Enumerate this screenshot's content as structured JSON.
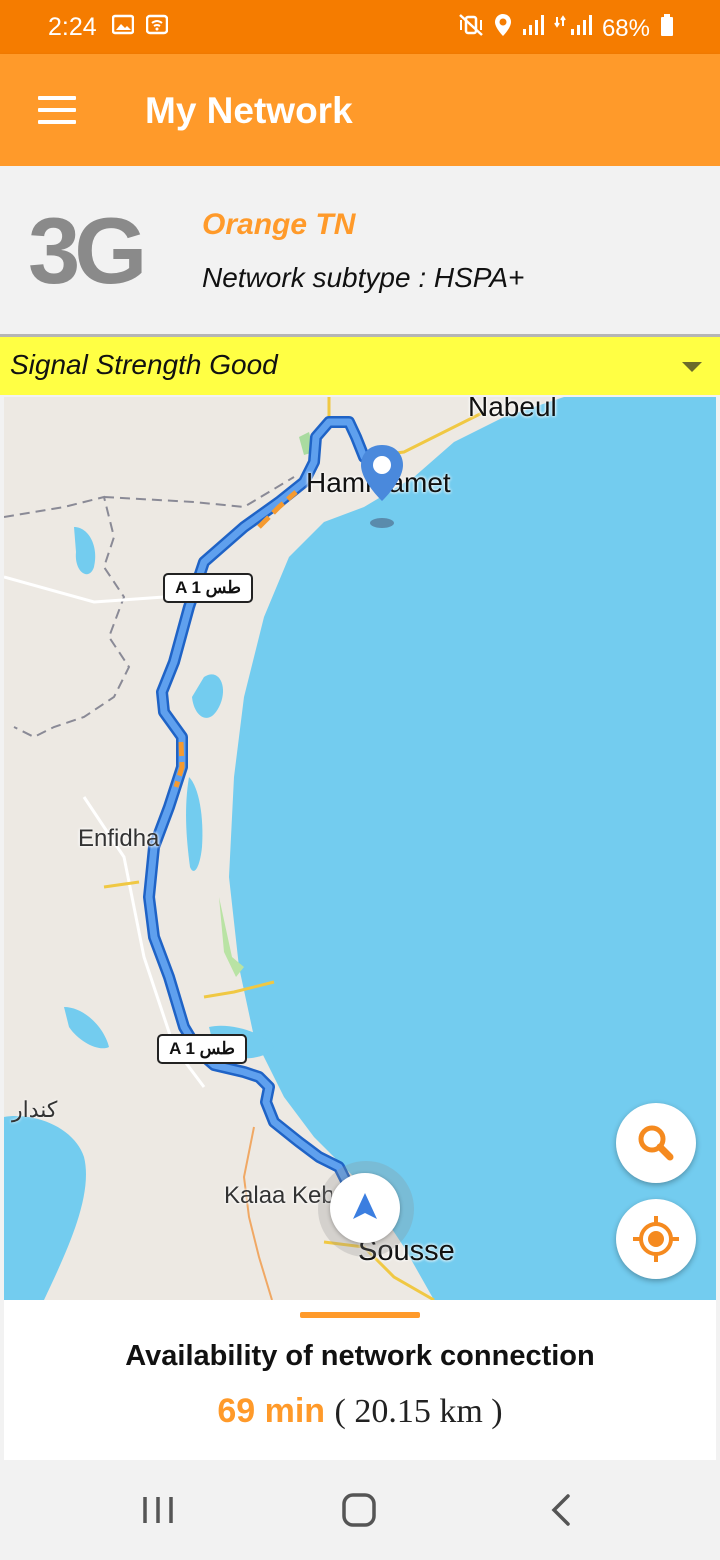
{
  "status_bar": {
    "time": "2:24",
    "battery": "68%",
    "icons": [
      "gallery-icon",
      "wifi-icon",
      "mute-vibrate-icon",
      "location-icon",
      "signal-icon",
      "signal-icon",
      "battery-icon"
    ]
  },
  "app_bar": {
    "title": "My Network",
    "menu_icon": "menu-icon"
  },
  "network": {
    "generation": "3G",
    "carrier": "Orange TN",
    "subtype": "Network subtype : HSPA+"
  },
  "signal": {
    "label": "Signal Strength Good",
    "selector_icon": "dropdown-icon"
  },
  "map": {
    "places": {
      "nabeul": "Nabeul",
      "hammamet": "Hammamet",
      "enfidha": "Enfidha",
      "kondar": "كندار",
      "kalaa": "Kalaa Kebira",
      "sousse": "Sousse"
    },
    "road_shields": [
      "A 1 طس",
      "A 1 طس"
    ],
    "buttons": {
      "search_icon": "search-icon",
      "locate_icon": "my-location-icon"
    }
  },
  "availability": {
    "title": "Availability of network connection",
    "time": "69 min",
    "distance": "( 20.15 km )"
  },
  "colors": {
    "status_bar": "#f57c00",
    "app_bar": "#ff9a2a",
    "signal_bar": "#ffff44",
    "route": "#4a89dc",
    "water": "#73ccef"
  },
  "nav_bar": {
    "icons": [
      "recent-apps-icon",
      "home-icon",
      "back-icon"
    ]
  }
}
